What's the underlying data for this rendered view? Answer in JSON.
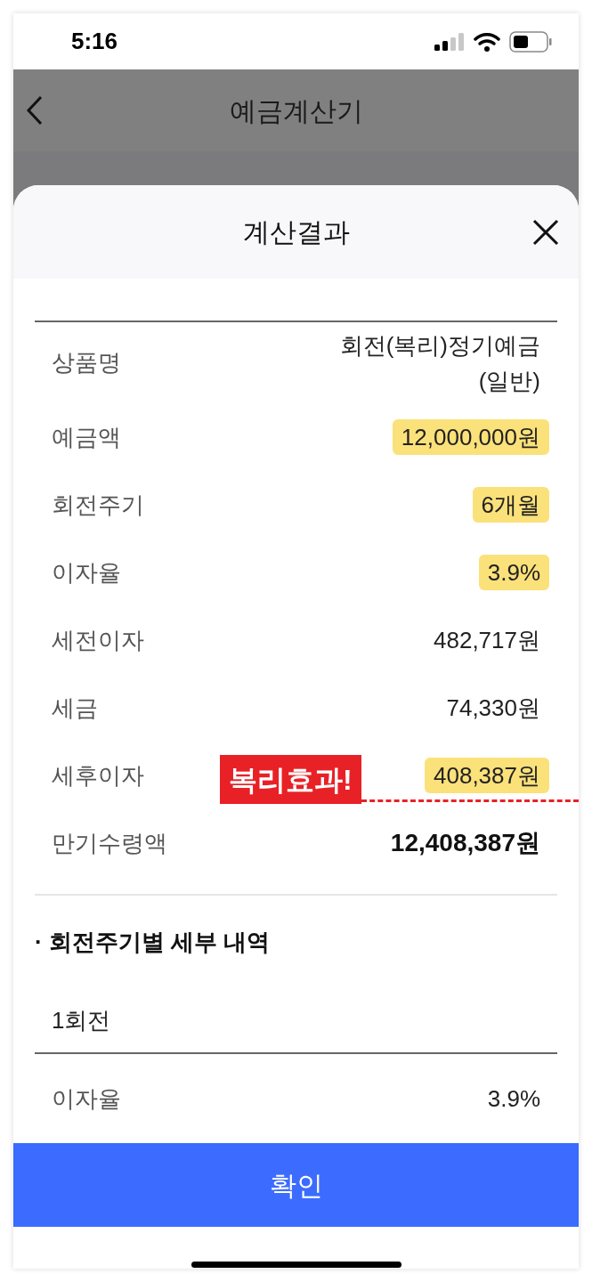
{
  "status_bar": {
    "time": "5:16"
  },
  "nav": {
    "title": "예금계산기"
  },
  "sheet": {
    "title": "계산결과",
    "rows": [
      {
        "kind": "normal",
        "label": "상품명",
        "value": "회전(복리)정기예금\n(일반)",
        "highlighted": false
      },
      {
        "kind": "normal",
        "label": "예금액",
        "value": "12,000,000원",
        "highlighted": true
      },
      {
        "kind": "normal",
        "label": "회전주기",
        "value": "6개월",
        "highlighted": true
      },
      {
        "kind": "normal",
        "label": "이자율",
        "value": "3.9%",
        "highlighted": true
      },
      {
        "kind": "normal",
        "label": "세전이자",
        "value": "482,717원",
        "highlighted": false
      },
      {
        "kind": "normal",
        "label": "세금",
        "value": "74,330원",
        "highlighted": false
      },
      {
        "kind": "normal",
        "label": "세후이자",
        "value": "408,387원",
        "highlighted": true,
        "annotation": "복리효과!"
      },
      {
        "kind": "total",
        "label": "만기수령액",
        "value": "12,408,387원",
        "highlighted": false
      }
    ],
    "section_title": "· 회전주기별 세부 내역",
    "rounds": [
      {
        "label": "1회전",
        "rows": [
          {
            "label": "이자율",
            "value": "3.9%"
          }
        ]
      }
    ],
    "confirm_button": "확인"
  }
}
